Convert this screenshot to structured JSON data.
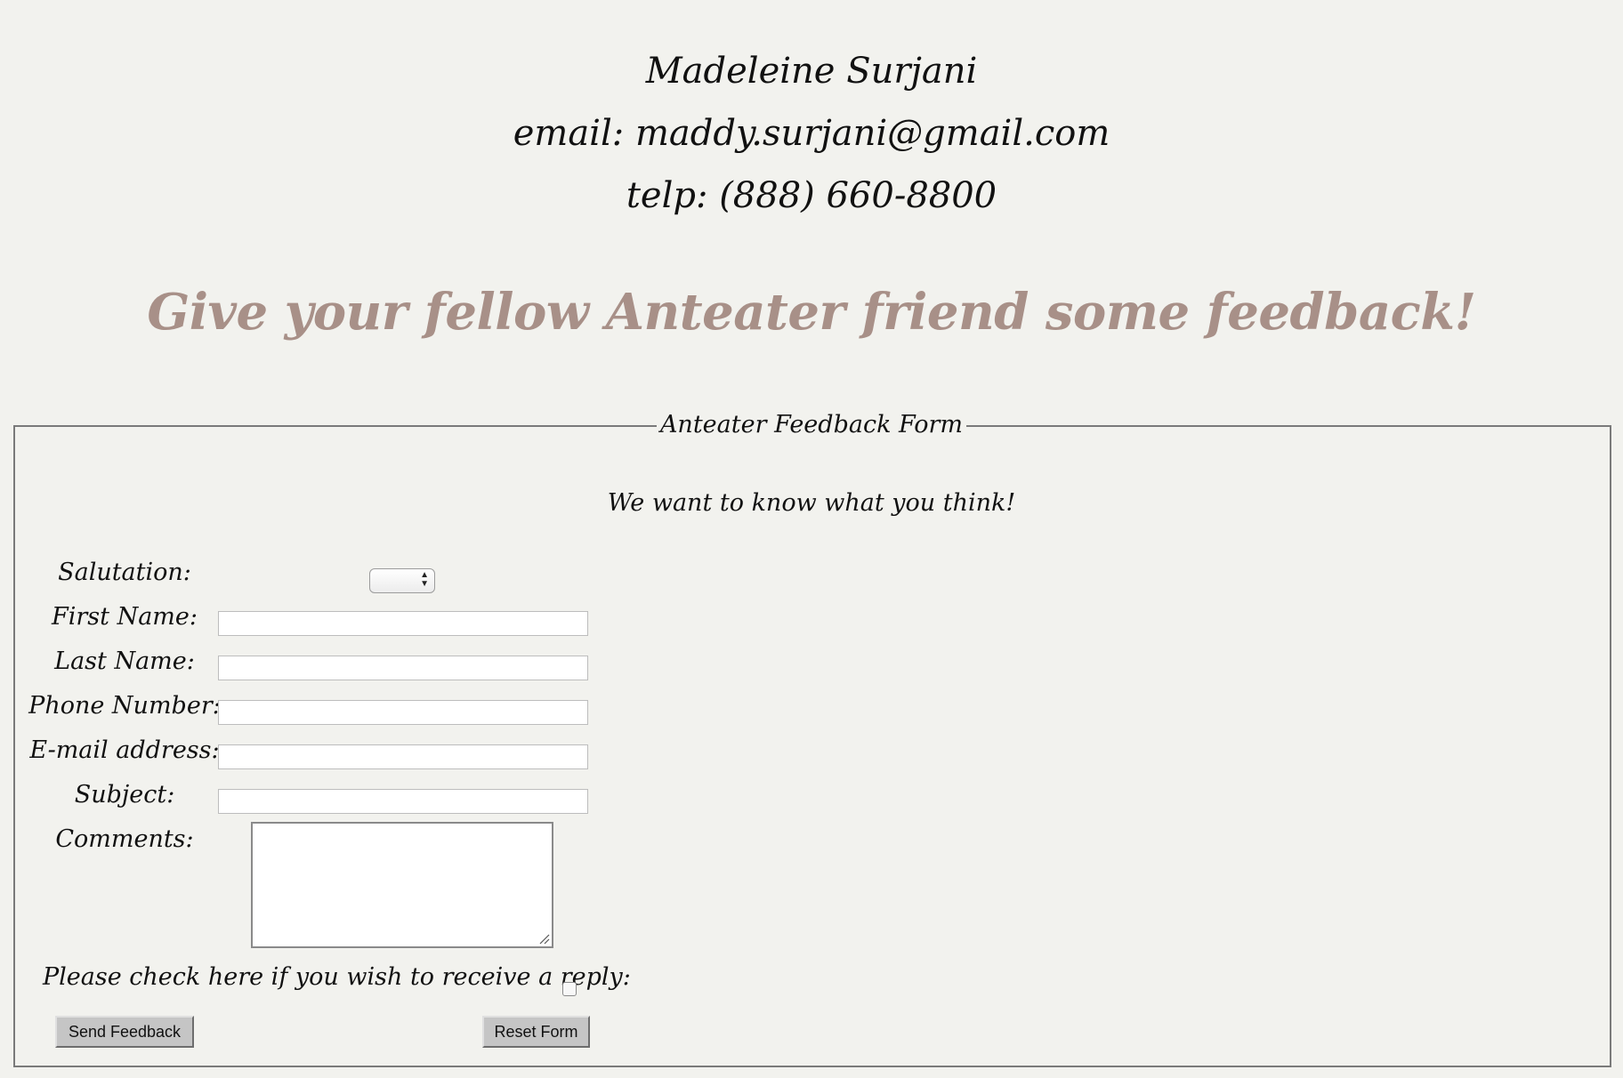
{
  "contact": {
    "name": "Madeleine Surjani",
    "email_line": "email: maddy.surjani@gmail.com",
    "phone_line": "telp: (888) 660-8800"
  },
  "tagline": "Give your fellow Anteater friend some feedback!",
  "form": {
    "legend": "Anteater Feedback Form",
    "intro": "We want to know what you think!",
    "labels": {
      "salutation": "Salutation:",
      "first_name": "First Name:",
      "last_name": "Last Name:",
      "phone": "Phone Number:",
      "email": "E-mail address:",
      "subject": "Subject:",
      "comments": "Comments:"
    },
    "values": {
      "salutation": "",
      "first_name": "",
      "last_name": "",
      "phone": "",
      "email": "",
      "subject": "",
      "comments": ""
    },
    "reply_label": "Please check here if you wish to receive a reply:",
    "reply_checked": false,
    "buttons": {
      "send": "Send Feedback",
      "reset": "Reset Form"
    }
  }
}
